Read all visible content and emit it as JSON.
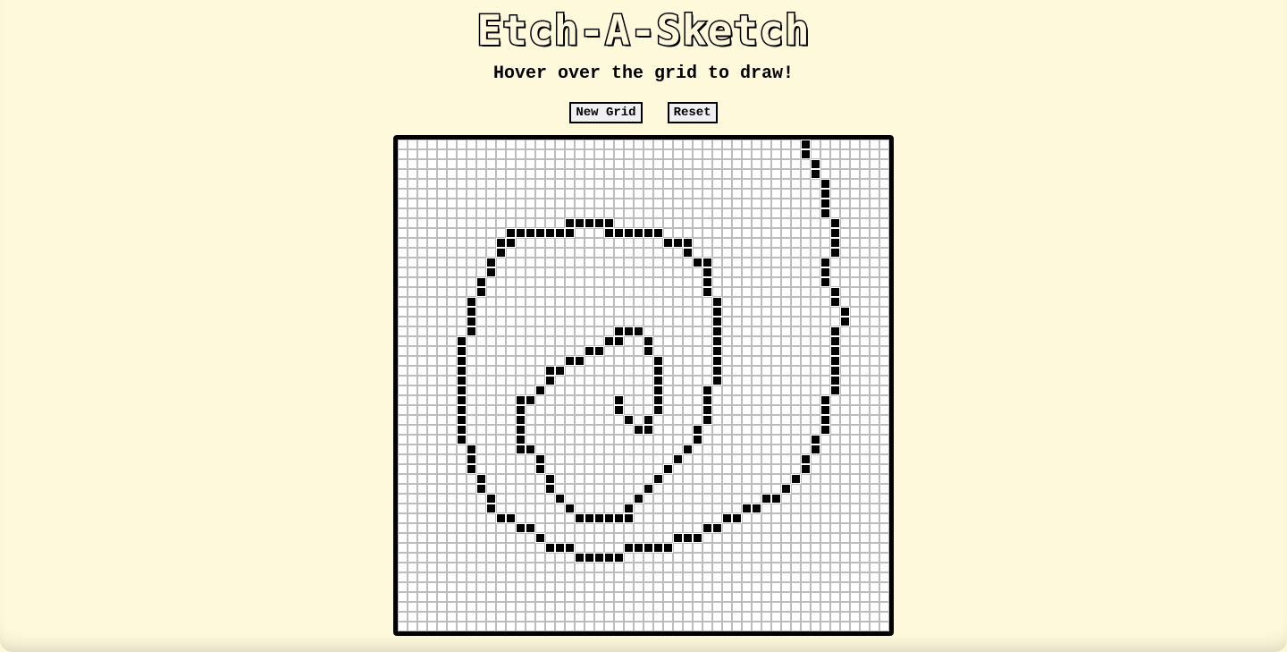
{
  "app": {
    "title": "Etch-A-Sketch",
    "subtitle": "Hover over the grid to draw!"
  },
  "controls": {
    "new_grid_label": "New Grid",
    "reset_label": "Reset"
  },
  "grid": {
    "size": 50,
    "cell_color": "#ffffff",
    "line_color": "#bcbcbc",
    "ink_color": "#000000",
    "drawn_cells": [
      [
        41,
        0
      ],
      [
        41,
        1
      ],
      [
        42,
        2
      ],
      [
        42,
        3
      ],
      [
        43,
        4
      ],
      [
        43,
        5
      ],
      [
        43,
        6
      ],
      [
        43,
        7
      ],
      [
        44,
        8
      ],
      [
        44,
        9
      ],
      [
        44,
        10
      ],
      [
        44,
        11
      ],
      [
        43,
        12
      ],
      [
        43,
        13
      ],
      [
        43,
        14
      ],
      [
        44,
        15
      ],
      [
        44,
        16
      ],
      [
        45,
        17
      ],
      [
        45,
        18
      ],
      [
        44,
        19
      ],
      [
        44,
        20
      ],
      [
        44,
        21
      ],
      [
        44,
        22
      ],
      [
        44,
        23
      ],
      [
        44,
        24
      ],
      [
        44,
        25
      ],
      [
        43,
        26
      ],
      [
        43,
        27
      ],
      [
        43,
        28
      ],
      [
        43,
        29
      ],
      [
        42,
        30
      ],
      [
        42,
        31
      ],
      [
        41,
        32
      ],
      [
        41,
        33
      ],
      [
        40,
        34
      ],
      [
        39,
        35
      ],
      [
        38,
        36
      ],
      [
        37,
        36
      ],
      [
        36,
        37
      ],
      [
        35,
        37
      ],
      [
        34,
        38
      ],
      [
        33,
        38
      ],
      [
        32,
        39
      ],
      [
        31,
        39
      ],
      [
        30,
        40
      ],
      [
        29,
        40
      ],
      [
        28,
        40
      ],
      [
        27,
        41
      ],
      [
        26,
        41
      ],
      [
        25,
        41
      ],
      [
        24,
        41
      ],
      [
        23,
        41
      ],
      [
        22,
        42
      ],
      [
        21,
        42
      ],
      [
        20,
        42
      ],
      [
        19,
        42
      ],
      [
        18,
        42
      ],
      [
        17,
        41
      ],
      [
        16,
        41
      ],
      [
        15,
        41
      ],
      [
        14,
        40
      ],
      [
        13,
        39
      ],
      [
        12,
        39
      ],
      [
        11,
        38
      ],
      [
        10,
        38
      ],
      [
        9,
        37
      ],
      [
        9,
        36
      ],
      [
        8,
        35
      ],
      [
        8,
        34
      ],
      [
        7,
        33
      ],
      [
        7,
        32
      ],
      [
        7,
        31
      ],
      [
        6,
        30
      ],
      [
        6,
        29
      ],
      [
        6,
        28
      ],
      [
        6,
        27
      ],
      [
        6,
        26
      ],
      [
        6,
        25
      ],
      [
        6,
        24
      ],
      [
        6,
        23
      ],
      [
        6,
        22
      ],
      [
        6,
        21
      ],
      [
        6,
        20
      ],
      [
        7,
        19
      ],
      [
        7,
        18
      ],
      [
        7,
        17
      ],
      [
        7,
        16
      ],
      [
        8,
        15
      ],
      [
        8,
        14
      ],
      [
        9,
        13
      ],
      [
        9,
        12
      ],
      [
        10,
        11
      ],
      [
        10,
        10
      ],
      [
        11,
        10
      ],
      [
        11,
        9
      ],
      [
        12,
        9
      ],
      [
        13,
        9
      ],
      [
        14,
        9
      ],
      [
        15,
        9
      ],
      [
        16,
        9
      ],
      [
        17,
        9
      ],
      [
        17,
        8
      ],
      [
        18,
        8
      ],
      [
        19,
        8
      ],
      [
        20,
        8
      ],
      [
        21,
        8
      ],
      [
        21,
        9
      ],
      [
        22,
        9
      ],
      [
        23,
        9
      ],
      [
        24,
        9
      ],
      [
        25,
        9
      ],
      [
        26,
        9
      ],
      [
        27,
        10
      ],
      [
        28,
        10
      ],
      [
        29,
        10
      ],
      [
        29,
        11
      ],
      [
        30,
        12
      ],
      [
        31,
        12
      ],
      [
        31,
        13
      ],
      [
        31,
        14
      ],
      [
        31,
        15
      ],
      [
        32,
        16
      ],
      [
        32,
        17
      ],
      [
        32,
        18
      ],
      [
        32,
        19
      ],
      [
        32,
        20
      ],
      [
        32,
        21
      ],
      [
        32,
        22
      ],
      [
        32,
        23
      ],
      [
        32,
        24
      ],
      [
        31,
        25
      ],
      [
        31,
        26
      ],
      [
        31,
        27
      ],
      [
        31,
        28
      ],
      [
        30,
        29
      ],
      [
        30,
        30
      ],
      [
        29,
        31
      ],
      [
        28,
        32
      ],
      [
        27,
        33
      ],
      [
        26,
        34
      ],
      [
        25,
        35
      ],
      [
        24,
        36
      ],
      [
        23,
        37
      ],
      [
        23,
        38
      ],
      [
        22,
        38
      ],
      [
        21,
        38
      ],
      [
        20,
        38
      ],
      [
        19,
        38
      ],
      [
        18,
        38
      ],
      [
        17,
        37
      ],
      [
        16,
        36
      ],
      [
        15,
        35
      ],
      [
        15,
        34
      ],
      [
        14,
        33
      ],
      [
        14,
        32
      ],
      [
        13,
        31
      ],
      [
        12,
        31
      ],
      [
        12,
        30
      ],
      [
        12,
        29
      ],
      [
        12,
        28
      ],
      [
        12,
        27
      ],
      [
        12,
        26
      ],
      [
        13,
        26
      ],
      [
        14,
        25
      ],
      [
        15,
        24
      ],
      [
        15,
        23
      ],
      [
        16,
        23
      ],
      [
        17,
        22
      ],
      [
        18,
        22
      ],
      [
        19,
        21
      ],
      [
        20,
        21
      ],
      [
        21,
        20
      ],
      [
        22,
        20
      ],
      [
        22,
        19
      ],
      [
        23,
        19
      ],
      [
        24,
        19
      ],
      [
        25,
        20
      ],
      [
        25,
        21
      ],
      [
        26,
        22
      ],
      [
        26,
        23
      ],
      [
        26,
        24
      ],
      [
        26,
        25
      ],
      [
        26,
        26
      ],
      [
        26,
        27
      ],
      [
        25,
        28
      ],
      [
        25,
        29
      ],
      [
        24,
        29
      ],
      [
        23,
        28
      ],
      [
        22,
        27
      ],
      [
        22,
        26
      ]
    ]
  }
}
